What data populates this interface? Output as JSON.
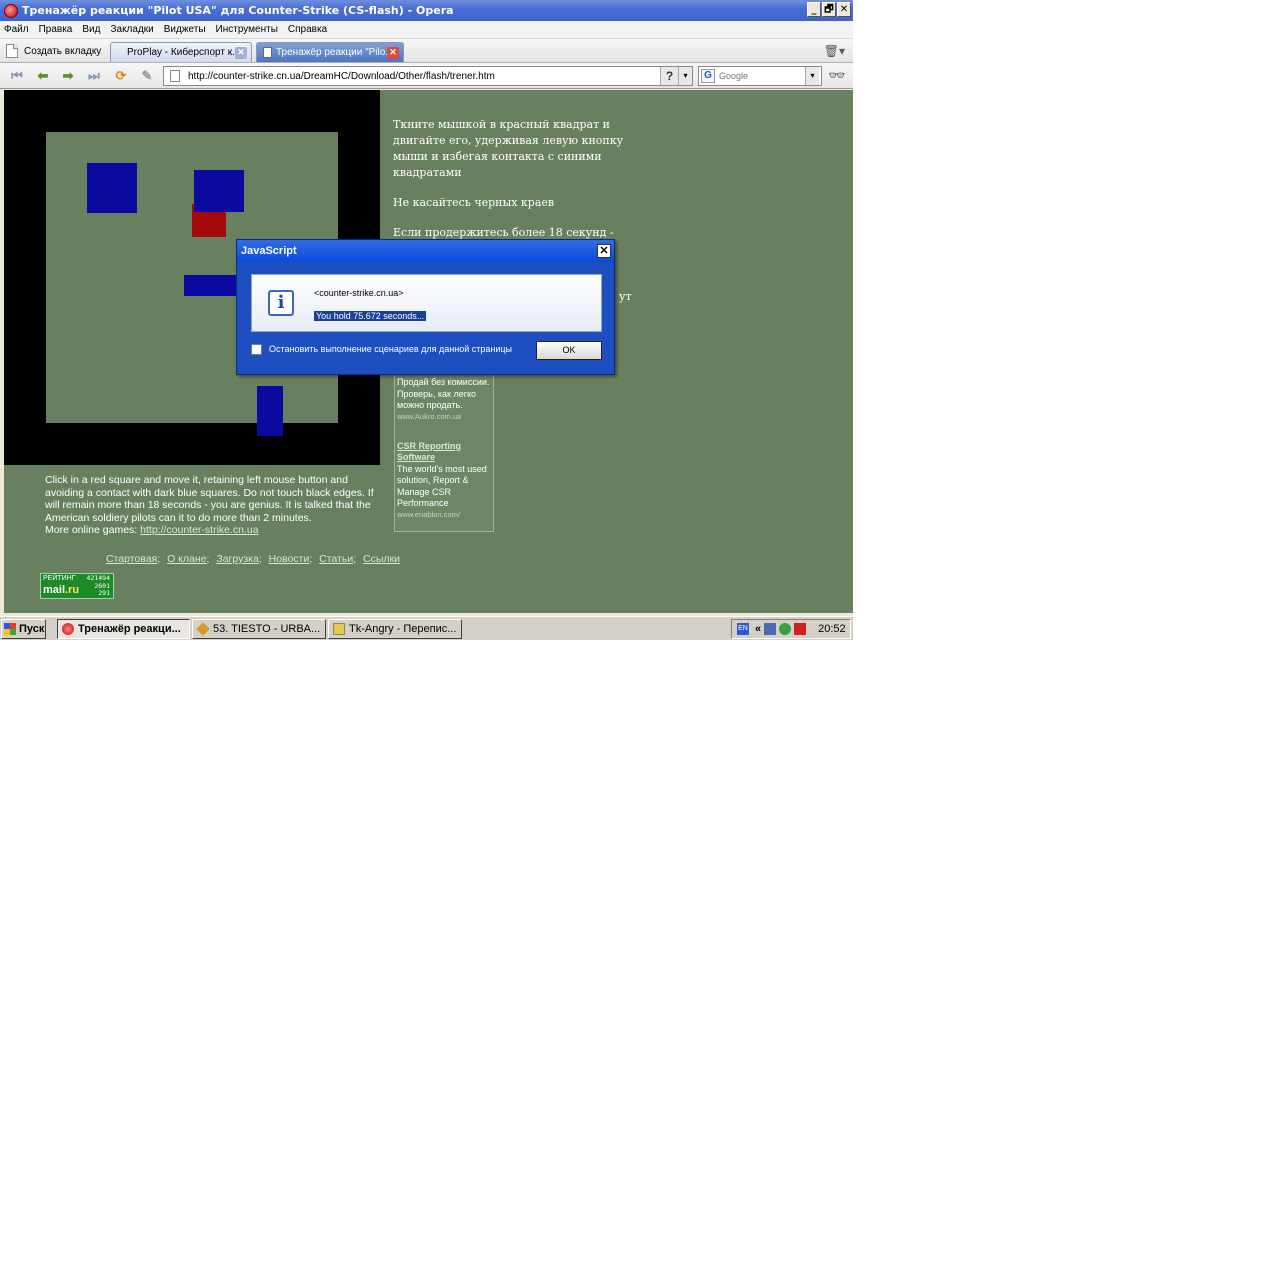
{
  "window": {
    "title": "Тренажёр реакции \"Pilot USA\" для Counter-Strike (CS-flash) - Opera",
    "minimize": "_",
    "maximize": "🗗",
    "close": "✕"
  },
  "menu": [
    "Файл",
    "Правка",
    "Вид",
    "Закладки",
    "Виджеты",
    "Инструменты",
    "Справка"
  ],
  "tabs": {
    "new_tab": "Создать вкладку",
    "items": [
      {
        "label": "ProPlay - Киберспорт к..."
      },
      {
        "label": "Тренажёр реакции \"Pilo..."
      }
    ],
    "close_glyph": "✕"
  },
  "toolbar": {
    "url": "http://counter-strike.cn.ua/DreamHC/Download/Other/flash/trener.htm",
    "help": "?",
    "dropdown": "▾",
    "search_placeholder": "Google",
    "search_engine_letter": "G"
  },
  "page": {
    "instructions": [
      "Ткните мышкой в красный квадрат и двигайте его, удерживая левую кнопку мыши и избегая контакта с синими квадратами",
      "Не касайтесь черных краев",
      "Если продержитесь более 18 секунд - вы"
    ],
    "instructions_cut": "ут",
    "ad": {
      "text1": "Продай без комиссии. Проверь, как легко можно продать.",
      "url1": "www.Aukro.com.ua",
      "link2": "CSR Reporting Software",
      "text2": "The world's most used solution, Report & Manage CSR Performance",
      "url2": "www.enablon.com/"
    },
    "english_text": "Click in a red square and move it, retaining left mouse button and avoiding a contact with dark blue squares. Do not touch black edges. If will remain more than 18 seconds - you are genius. It is talked that the American soldiery pilots can it to do more than 2 minutes.",
    "more_games_label": "More online games:",
    "more_games_link": "http://counter-strike.cn.ua",
    "footer_links": [
      "Стартовая",
      "О клане",
      "Загрузка",
      "Новости",
      "Статьи",
      "Ссылки"
    ],
    "footer_sep": ";",
    "counter": {
      "label": "РЕЙТИНГ",
      "brand_main": "mail",
      "brand_suffix": ".ru",
      "n1": "421494",
      "n2": "2601",
      "n3": "291"
    }
  },
  "dialog": {
    "title": "JavaScript",
    "close": "✕",
    "icon": "i",
    "origin": "<counter-strike.cn.ua>",
    "message": "You hold 75.672 seconds...",
    "checkbox_label": "Остановить выполнение сценариев для данной страницы",
    "ok": "OK"
  },
  "taskbar": {
    "start": "Пуск",
    "tasks": [
      {
        "label": "Тренажёр реакци..."
      },
      {
        "label": "53. TIESTO - URBA..."
      },
      {
        "label": "Tk-Angry - Перепис..."
      }
    ],
    "lang": "EN",
    "chevron": "«",
    "clock": "20:52"
  },
  "colors": {
    "page_bg": "#688060",
    "blue_block": "#0a0aa0",
    "red_block": "#a40808",
    "title_blue": "#3d64cc"
  }
}
